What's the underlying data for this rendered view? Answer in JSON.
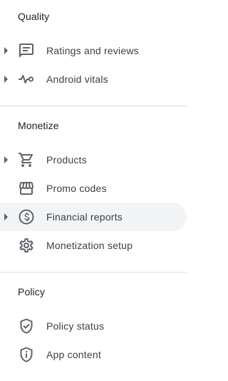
{
  "sections": [
    {
      "header": "Quality",
      "items": [
        {
          "label": "Ratings and reviews",
          "icon": "ratings-icon",
          "expandable": true
        },
        {
          "label": "Android vitals",
          "icon": "vitals-icon",
          "expandable": true
        }
      ]
    },
    {
      "header": "Monetize",
      "items": [
        {
          "label": "Products",
          "icon": "cart-icon",
          "expandable": true
        },
        {
          "label": "Promo codes",
          "icon": "store-icon",
          "expandable": false
        },
        {
          "label": "Financial reports",
          "icon": "dollar-icon",
          "expandable": true,
          "active": true
        },
        {
          "label": "Monetization setup",
          "icon": "gear-icon",
          "expandable": false
        }
      ]
    },
    {
      "header": "Policy",
      "items": [
        {
          "label": "Policy status",
          "icon": "shield-check-icon",
          "expandable": false
        },
        {
          "label": "App content",
          "icon": "shield-info-icon",
          "expandable": false
        }
      ]
    }
  ],
  "colors": {
    "text": "#3c4043",
    "header": "#202124",
    "icon": "#5f6368",
    "active_bg": "#f3f4f6",
    "divider": "#e0e0e0"
  }
}
